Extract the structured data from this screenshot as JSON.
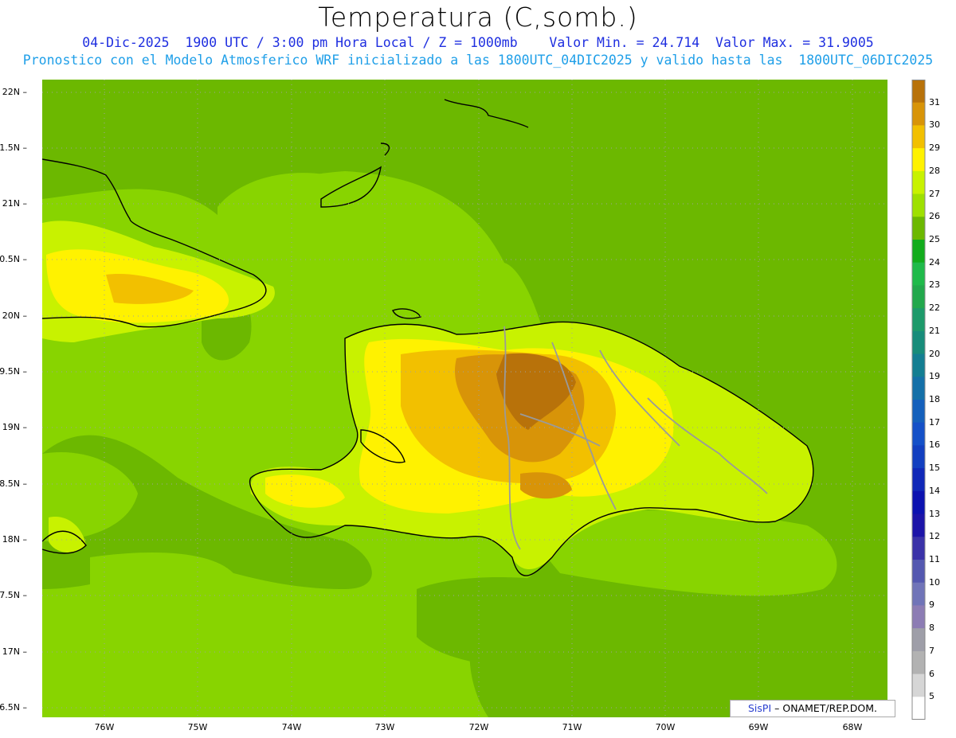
{
  "header": {
    "title": "Temperatura (C,somb.)",
    "line1": "04-Dic-2025  1900 UTC / 3:00 pm Hora Local / Z = 1000mb    Valor Min. = 24.714  Valor Max. = 31.9005",
    "line2": "Pronostico con el Modelo Atmosferico WRF inicializado a las 1800UTC_04DIC2025 y valido hasta las  1800UTC_06DIC2025"
  },
  "axes": {
    "y_labels": [
      "22N",
      "1.5N",
      "21N",
      "0.5N",
      "20N",
      "9.5N",
      "19N",
      "8.5N",
      "18N",
      "7.5N",
      "17N",
      "6.5N"
    ],
    "x_labels": [
      "76W",
      "75W",
      "74W",
      "73W",
      "72W",
      "71W",
      "70W",
      "69W",
      "68W"
    ]
  },
  "colorbar": {
    "labels": [
      "31",
      "30",
      "29",
      "28",
      "27",
      "26",
      "25",
      "24",
      "23",
      "22",
      "21",
      "20",
      "19",
      "18",
      "17",
      "16",
      "15",
      "14",
      "13",
      "12",
      "11",
      "10",
      "9",
      "8",
      "7",
      "6",
      "5"
    ],
    "colors": [
      "#b8720a",
      "#d89408",
      "#f2c000",
      "#fff200",
      "#c8f200",
      "#9ee000",
      "#6cb800",
      "#12ac1c",
      "#1fba4a",
      "#22a84c",
      "#1d9a6a",
      "#178c7a",
      "#137e92",
      "#1470a8",
      "#1460bc",
      "#1450c8",
      "#123fc0",
      "#1028b8",
      "#0c12b0",
      "#1c14a8",
      "#3a32a8",
      "#5458b0",
      "#7074b8",
      "#8c7cb4",
      "#9e9ea8",
      "#b2b2b2",
      "#d6d6d6",
      "#ffffff"
    ]
  },
  "legend_colors": {
    "sea": "#88d400",
    "land_warm": "#c8f200",
    "hot1": "#fff200",
    "hot2": "#f2c000",
    "hot3": "#d89408",
    "hot4": "#b8720a",
    "cool": "#6cb800"
  },
  "credit": {
    "brand": "SisPI",
    "text": " –  ONAMET/REP.DOM."
  }
}
